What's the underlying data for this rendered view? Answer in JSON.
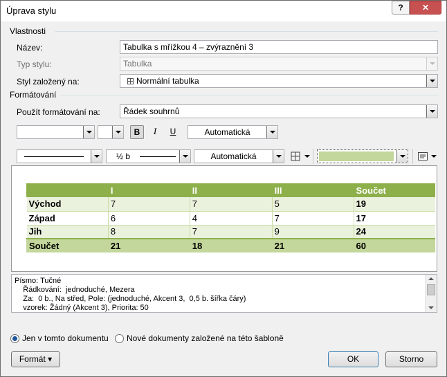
{
  "window": {
    "title": "Úprava stylu",
    "help_label": "?",
    "close_label": "✕"
  },
  "properties": {
    "section_title": "Vlastnosti",
    "name_label": "Název:",
    "name_value": "Tabulka s mřížkou 4 – zvýraznění 3",
    "type_label": "Typ stylu:",
    "type_value": "Tabulka",
    "based_on_label": "Styl založený na:",
    "based_on_value": "Normální tabulka"
  },
  "formatting": {
    "section_title": "Formátování",
    "apply_to_label": "Použít formátování na:",
    "apply_to_value": "Řádek souhrnů",
    "font_value": "",
    "size_value": "",
    "bold_label": "B",
    "italic_label": "I",
    "underline_label": "U",
    "font_color_value": "Automatická",
    "border_width_value": "½ b",
    "border_color_value": "Automatická",
    "shading_color": "#c3d69b"
  },
  "preview_table": {
    "header": [
      "",
      "I",
      "II",
      "III",
      "Součet"
    ],
    "rows": [
      [
        "Východ",
        "7",
        "7",
        "5",
        "19"
      ],
      [
        "Západ",
        "6",
        "4",
        "7",
        "17"
      ],
      [
        "Jih",
        "8",
        "7",
        "9",
        "24"
      ]
    ],
    "total": [
      "Součet",
      "21",
      "18",
      "21",
      "60"
    ]
  },
  "description": {
    "lines": [
      "Písmo: Tučné",
      "    Řádkování:  jednoduché, Mezera",
      "    Za:  0 b., Na střed, Pole: (jednoduché, Akcent 3,  0,5 b. šířka čáry)",
      "    vzorek: Žádný (Akcent 3), Priorita: 50"
    ]
  },
  "options": {
    "this_document_label": "Jen v tomto dokumentu",
    "new_documents_label": "Nové dokumenty založené na této šabloně"
  },
  "buttons": {
    "format_label": "Formát ▾",
    "ok_label": "OK",
    "cancel_label": "Storno"
  },
  "colors": {
    "accent": "#8db04a",
    "band": "#eaf1dd",
    "total": "#c3d69b"
  }
}
